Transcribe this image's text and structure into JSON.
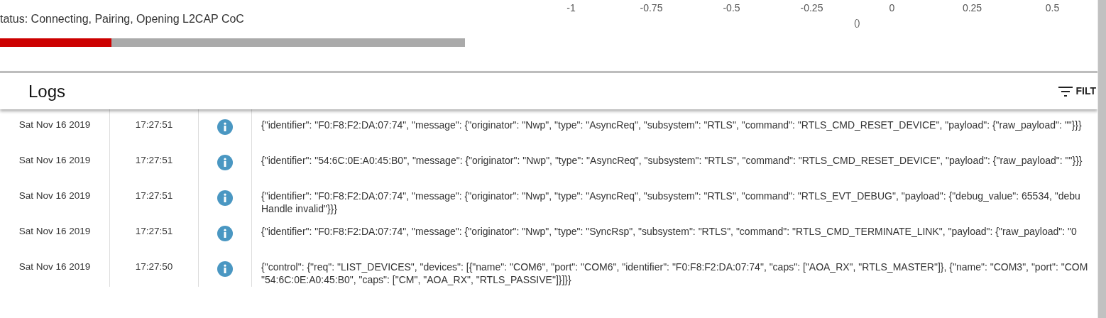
{
  "status": {
    "text": "tatus: Connecting, Pairing, Opening L2CAP CoC"
  },
  "progress": {
    "level": 0.24
  },
  "chart": {
    "x_ticks": [
      "-1",
      "-0.75",
      "-0.5",
      "-0.25",
      "0",
      "0.25",
      "0.5"
    ],
    "x_label": "()"
  },
  "logs": {
    "title": "Logs",
    "filter_button": "FILT",
    "rows": [
      {
        "date": "Sat Nov 16 2019",
        "time": "17:27:51",
        "kind": "info",
        "message": [
          "{\"identifier\": \"F0:F8:F2:DA:07:74\", \"message\": {\"originator\": \"Nwp\", \"type\": \"AsyncReq\", \"subsystem\": \"RTLS\", \"command\": \"RTLS_CMD_RESET_DEVICE\", \"payload\": {\"raw_payload\": \"\"}}}"
        ]
      },
      {
        "date": "Sat Nov 16 2019",
        "time": "17:27:51",
        "kind": "info",
        "message": [
          "{\"identifier\": \"54:6C:0E:A0:45:B0\", \"message\": {\"originator\": \"Nwp\", \"type\": \"AsyncReq\", \"subsystem\": \"RTLS\", \"command\": \"RTLS_CMD_RESET_DEVICE\", \"payload\": {\"raw_payload\": \"\"}}}"
        ]
      },
      {
        "date": "Sat Nov 16 2019",
        "time": "17:27:51",
        "kind": "info",
        "message": [
          "{\"identifier\": \"F0:F8:F2:DA:07:74\", \"message\": {\"originator\": \"Nwp\", \"type\": \"AsyncReq\", \"subsystem\": \"RTLS\", \"command\": \"RTLS_EVT_DEBUG\", \"payload\": {\"debug_value\": 65534, \"debu",
          "Handle invalid\"}}}"
        ]
      },
      {
        "date": "Sat Nov 16 2019",
        "time": "17:27:51",
        "kind": "info",
        "message": [
          "{\"identifier\": \"F0:F8:F2:DA:07:74\", \"message\": {\"originator\": \"Nwp\", \"type\": \"SyncRsp\", \"subsystem\": \"RTLS\", \"command\": \"RTLS_CMD_TERMINATE_LINK\", \"payload\": {\"raw_payload\": \"0"
        ]
      },
      {
        "date": "Sat Nov 16 2019",
        "time": "17:27:50",
        "kind": "info",
        "message": [
          "{\"control\": {\"req\": \"LIST_DEVICES\", \"devices\": [{\"name\": \"COM6\", \"port\": \"COM6\", \"identifier\": \"F0:F8:F2:DA:07:74\", \"caps\": [\"AOA_RX\", \"RTLS_MASTER\"]}, {\"name\": \"COM3\", \"port\": \"COM",
          "\"54:6C:0E:A0:45:B0\", \"caps\": [\"CM\", \"AOA_RX\", \"RTLS_PASSIVE\"]}]}}"
        ]
      }
    ]
  }
}
